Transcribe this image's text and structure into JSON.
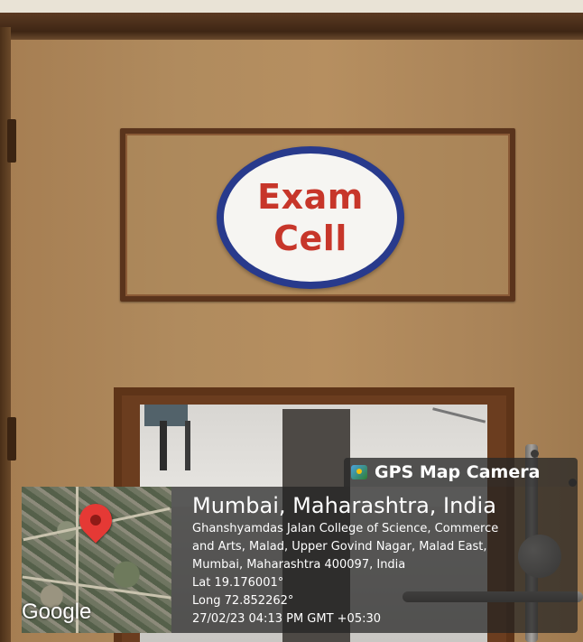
{
  "sign": {
    "line1": "Exam",
    "line2": "Cell"
  },
  "gps": {
    "brand": "GPS Map Camera",
    "brand_icon": "gps-camera-app-icon",
    "map_icon": "location-pin-icon",
    "map_provider": "Google",
    "location_title": "Mumbai, Maharashtra, India",
    "address_lines": [
      "Ghanshyamdas Jalan College of Science, Commerce",
      "and Arts, Malad, Upper Govind Nagar, Malad East,",
      "Mumbai, Maharashtra 400097, India"
    ],
    "latitude": "Lat 19.176001°",
    "longitude": "Long 72.852262°",
    "timestamp": "27/02/23 04:13 PM GMT +05:30"
  },
  "colors": {
    "sign_text": "#c7362a",
    "sign_border": "#283a8c",
    "pin": "#e53935"
  }
}
